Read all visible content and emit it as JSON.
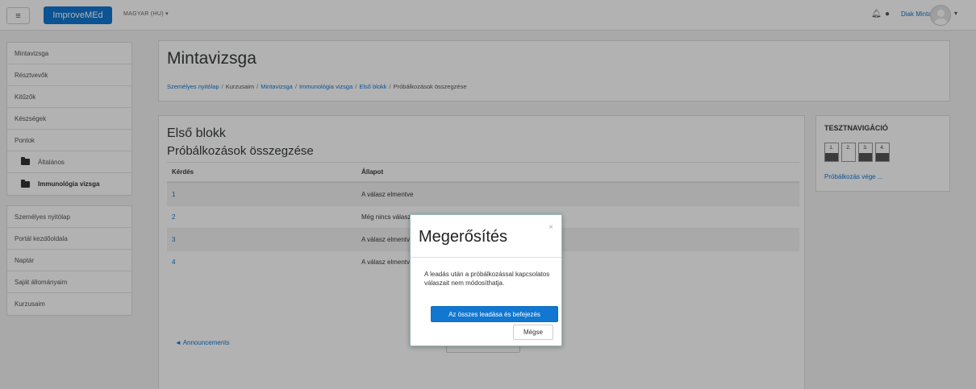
{
  "navbar": {
    "brand": "ImproveMEd",
    "language": "MAGYAR (HU) ▾",
    "user_name": "Diak Minta"
  },
  "sidebar": {
    "course_items": [
      {
        "label": "Mintavizsga"
      },
      {
        "label": "Résztvevők"
      },
      {
        "label": "Kitűzők"
      },
      {
        "label": "Készségek"
      },
      {
        "label": "Pontok"
      },
      {
        "label": "Általános"
      },
      {
        "label": "Immunológia vizsga"
      }
    ],
    "site_items": [
      {
        "label": "Személyes nyitólap"
      },
      {
        "label": "Portál kezdőoldala"
      },
      {
        "label": "Naptár"
      },
      {
        "label": "Saját állományaim"
      },
      {
        "label": "Kurzusaim"
      }
    ]
  },
  "header": {
    "title": "Mintavizsga",
    "breadcrumb": [
      "Személyes nyitólap",
      "Kurzusaim",
      "Mintavizsga",
      "Immunológia vizsga",
      "Első blokk",
      "Próbálkozások összegzése"
    ],
    "breadcrumb_sep": "/"
  },
  "main": {
    "block_title": "Első blokk",
    "summary_title": "Próbálkozások összegzése",
    "table": {
      "headers": [
        "Kérdés",
        "Állapot"
      ],
      "rows": [
        {
          "question": "1",
          "status": "A válasz elmentve"
        },
        {
          "question": "2",
          "status": "Még nincs válasz"
        },
        {
          "question": "3",
          "status": "A válasz elmentve"
        },
        {
          "question": "4",
          "status": "A válasz elmentve"
        }
      ]
    },
    "announcements_link": "◄ Announcements"
  },
  "quiz_nav": {
    "title": "TESZTNAVIGÁCIÓ",
    "questions": [
      "1.",
      "2.",
      "3.",
      "4."
    ],
    "finish_link": "Próbálkozás vége ..."
  },
  "modal": {
    "title": "Megerősítés",
    "close": "×",
    "body": "A leadás után a próbálkozással kapcsolatos válaszait nem módosíthatja.",
    "primary_button": "Az összes leadása és befejezés",
    "cancel_button": "Mégse"
  },
  "icons": {
    "menu": "hamburger-icon",
    "notifications": "bell-icon",
    "messages": "chat-bubble-icon",
    "folder": "folder-icon"
  },
  "colors": {
    "accent": "#1177d1",
    "overlay": "rgba(0,0,0,0.3)"
  }
}
